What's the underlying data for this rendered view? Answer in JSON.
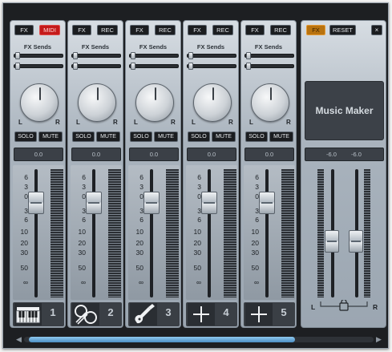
{
  "strips": [
    {
      "fx": "FX",
      "second": "MIDI",
      "second_style": "midi",
      "sends_label": "FX Sends",
      "solo": "SOLO",
      "mute": "MUTE",
      "volume": "0.0",
      "number": "1",
      "instrument_icon": "keyboard-icon"
    },
    {
      "fx": "FX",
      "second": "REC",
      "second_style": "rec",
      "sends_label": "FX Sends",
      "solo": "SOLO",
      "mute": "MUTE",
      "volume": "0.0",
      "number": "2",
      "instrument_icon": "drums-icon"
    },
    {
      "fx": "FX",
      "second": "REC",
      "second_style": "rec",
      "sends_label": "FX Sends",
      "solo": "SOLO",
      "mute": "MUTE",
      "volume": "0.0",
      "number": "3",
      "instrument_icon": "guitar-icon"
    },
    {
      "fx": "FX",
      "second": "REC",
      "second_style": "rec",
      "sends_label": "FX Sends",
      "solo": "SOLO",
      "mute": "MUTE",
      "volume": "0.0",
      "number": "4",
      "instrument_icon": "add-instrument-icon"
    },
    {
      "fx": "FX",
      "second": "REC",
      "second_style": "rec",
      "sends_label": "FX Sends",
      "solo": "SOLO",
      "mute": "MUTE",
      "volume": "0.0",
      "number": "5",
      "instrument_icon": "add-instrument-icon"
    }
  ],
  "pan": {
    "left": "L",
    "right": "R"
  },
  "scale": [
    "6",
    "3",
    "0",
    "3",
    "6",
    "10",
    "20",
    "30",
    "50",
    "∞"
  ],
  "master": {
    "fx": "FX",
    "reset": "RESET",
    "close": "×",
    "logo": "Music Maker",
    "level_left": "-6.0",
    "level_right": "-6.0",
    "left": "L",
    "right": "R",
    "link_icon": "lock-icon"
  },
  "colors": {
    "midi_active": "#c41a1a",
    "master_fx_active": "#b8720f",
    "scroll_thumb": "#4c8fc4"
  }
}
